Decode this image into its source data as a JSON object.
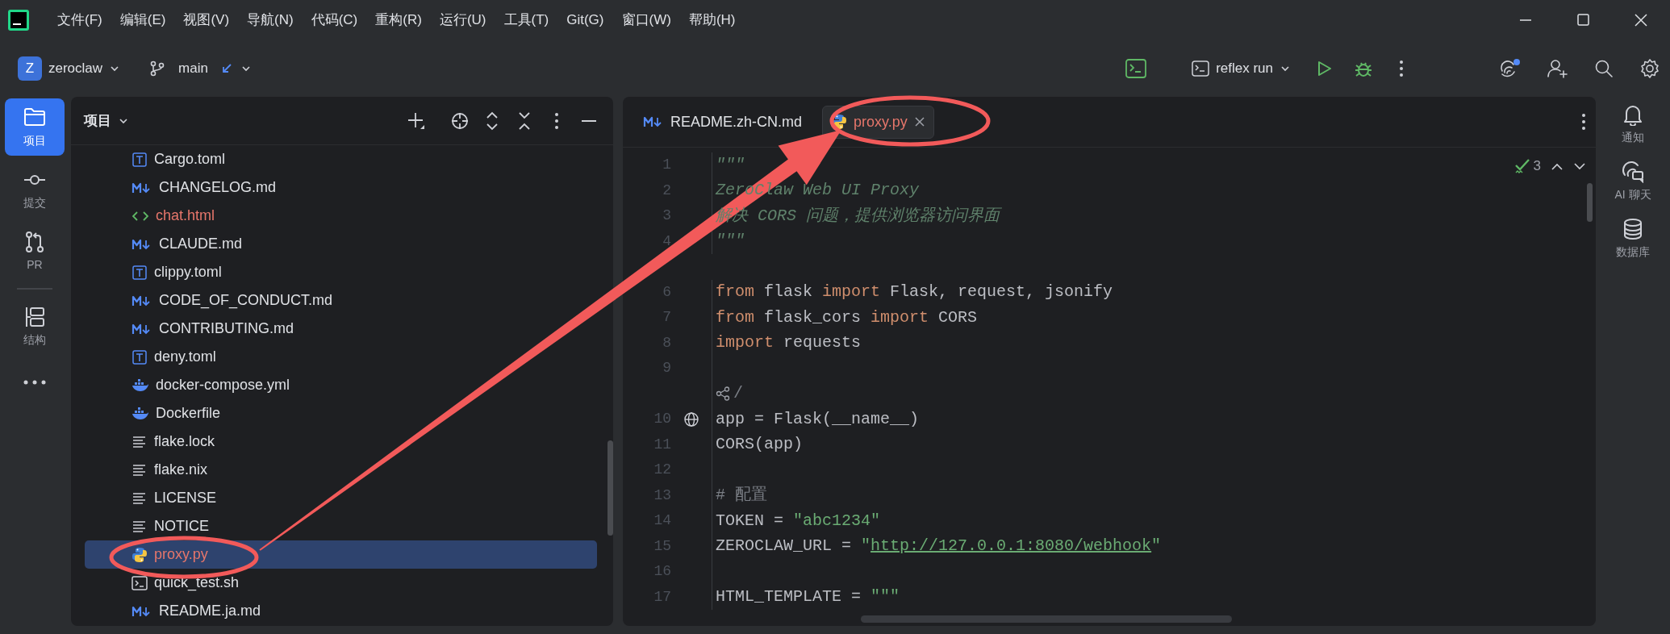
{
  "menu": [
    "文件(F)",
    "编辑(E)",
    "视图(V)",
    "导航(N)",
    "代码(C)",
    "重构(R)",
    "运行(U)",
    "工具(T)",
    "Git(G)",
    "窗口(W)",
    "帮助(H)"
  ],
  "project": {
    "avatar": "Z",
    "name": "zeroclaw"
  },
  "branch": {
    "name": "main"
  },
  "run_config": {
    "label": "reflex run"
  },
  "left_tools": [
    {
      "kind": "folder",
      "label": "项目",
      "selected": true
    },
    {
      "kind": "commit",
      "label": "提交",
      "selected": false
    },
    {
      "kind": "pr",
      "label": "PR",
      "selected": false
    },
    {
      "kind": "divider"
    },
    {
      "kind": "structure",
      "label": "结构",
      "selected": false
    },
    {
      "kind": "more"
    }
  ],
  "right_tools": [
    {
      "kind": "bell",
      "label": "通知"
    },
    {
      "kind": "ai",
      "label": "AI 聊天"
    },
    {
      "kind": "database",
      "label": "数据库"
    }
  ],
  "tree": {
    "title": "项目",
    "items": [
      {
        "label": "Cargo.toml",
        "kind": "toml",
        "unversioned": false,
        "selected": false
      },
      {
        "label": "CHANGELOG.md",
        "kind": "md",
        "unversioned": false,
        "selected": false
      },
      {
        "label": "chat.html",
        "kind": "html",
        "unversioned": true,
        "selected": false
      },
      {
        "label": "CLAUDE.md",
        "kind": "md",
        "unversioned": false,
        "selected": false
      },
      {
        "label": "clippy.toml",
        "kind": "toml",
        "unversioned": false,
        "selected": false
      },
      {
        "label": "CODE_OF_CONDUCT.md",
        "kind": "md",
        "unversioned": false,
        "selected": false
      },
      {
        "label": "CONTRIBUTING.md",
        "kind": "md",
        "unversioned": false,
        "selected": false
      },
      {
        "label": "deny.toml",
        "kind": "toml",
        "unversioned": false,
        "selected": false
      },
      {
        "label": "docker-compose.yml",
        "kind": "docker",
        "unversioned": false,
        "selected": false
      },
      {
        "label": "Dockerfile",
        "kind": "docker",
        "unversioned": false,
        "selected": false
      },
      {
        "label": "flake.lock",
        "kind": "text",
        "unversioned": false,
        "selected": false
      },
      {
        "label": "flake.nix",
        "kind": "text",
        "unversioned": false,
        "selected": false
      },
      {
        "label": "LICENSE",
        "kind": "text",
        "unversioned": false,
        "selected": false
      },
      {
        "label": "NOTICE",
        "kind": "text",
        "unversioned": false,
        "selected": false
      },
      {
        "label": "proxy.py",
        "kind": "python",
        "unversioned": true,
        "selected": true
      },
      {
        "label": "quick_test.sh",
        "kind": "shell",
        "unversioned": false,
        "selected": false
      },
      {
        "label": "README.ja.md",
        "kind": "md",
        "unversioned": false,
        "selected": false
      }
    ]
  },
  "editor": {
    "tabs": [
      {
        "label": "README.zh-CN.md",
        "kind": "md",
        "unversioned": false,
        "selected": false
      },
      {
        "label": "proxy.py",
        "kind": "python",
        "unversioned": true,
        "selected": true
      }
    ],
    "problems_count": "3",
    "lines": [
      {
        "num": "1",
        "tokens": [
          {
            "t": "\"\"\"",
            "kind": "doc"
          }
        ]
      },
      {
        "num": "2",
        "tokens": [
          {
            "t": "ZeroClaw Web UI Proxy",
            "kind": "doc"
          }
        ]
      },
      {
        "num": "3",
        "tokens": [
          {
            "t": "解决 CORS 问题，提供浏览器访问界面",
            "kind": "doc"
          }
        ]
      },
      {
        "num": "4",
        "tokens": [
          {
            "t": "\"\"\"",
            "kind": "doc"
          }
        ]
      },
      {
        "kind": "blank"
      },
      {
        "num": "6",
        "tokens": [
          {
            "t": "from",
            "kind": "kw"
          },
          {
            "t": " flask ",
            "kind": "n"
          },
          {
            "t": "import",
            "kind": "kw"
          },
          {
            "t": " Flask, request, jsonify",
            "kind": "n"
          }
        ]
      },
      {
        "num": "7",
        "tokens": [
          {
            "t": "from",
            "kind": "kw"
          },
          {
            "t": " flask_cors ",
            "kind": "n"
          },
          {
            "t": "import",
            "kind": "kw"
          },
          {
            "t": " CORS",
            "kind": "n"
          }
        ]
      },
      {
        "num": "8",
        "tokens": [
          {
            "t": "import",
            "kind": "kw"
          },
          {
            "t": " requests",
            "kind": "n"
          }
        ]
      },
      {
        "num": "9"
      },
      {
        "inlay": "/"
      },
      {
        "num": "10",
        "gutter_icon": true,
        "tokens": [
          {
            "t": "app = Flask(__name__)",
            "kind": "n"
          }
        ]
      },
      {
        "num": "11",
        "tokens": [
          {
            "t": "CORS(app)",
            "kind": "n"
          }
        ]
      },
      {
        "num": "12"
      },
      {
        "num": "13",
        "tokens": [
          {
            "t": "# 配置",
            "kind": "cmt"
          }
        ]
      },
      {
        "num": "14",
        "tokens": [
          {
            "t": "TOKEN = ",
            "kind": "n"
          },
          {
            "t": "\"abc1234\"",
            "kind": "str"
          }
        ]
      },
      {
        "num": "15",
        "tokens": [
          {
            "t": "ZEROCLAW_URL = ",
            "kind": "n"
          },
          {
            "t": "\"",
            "kind": "str"
          },
          {
            "t": "http://127.0.0.1:8080/webhook",
            "kind": "link"
          },
          {
            "t": "\"",
            "kind": "str"
          }
        ]
      },
      {
        "num": "16"
      },
      {
        "num": "17",
        "tokens": [
          {
            "t": "HTML_TEMPLATE = ",
            "kind": "n"
          },
          {
            "t": "\"\"\"",
            "kind": "str"
          }
        ]
      }
    ]
  }
}
